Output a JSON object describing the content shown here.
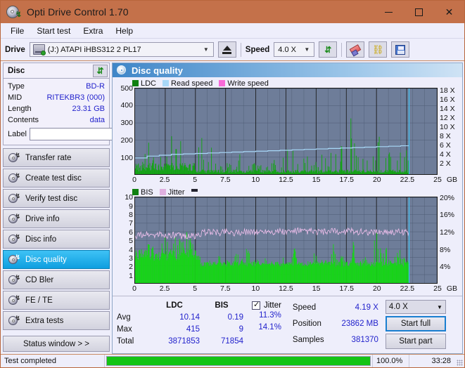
{
  "window": {
    "title": "Opti Drive Control 1.70",
    "icon": "disc-drive-icon",
    "minimize": "—",
    "maximize": "□",
    "close": "✕"
  },
  "menu": {
    "items": [
      {
        "label": "File"
      },
      {
        "label": "Start test"
      },
      {
        "label": "Extra"
      },
      {
        "label": "Help"
      }
    ]
  },
  "toolbar": {
    "drive_label": "Drive",
    "drive_value": "(J:)   ATAPI iHBS312   2 PL17",
    "eject_label": "eject-icon",
    "speed_label": "Speed",
    "speed_value": "4.0 X",
    "refresh_label": "↯",
    "erase_label": "eraser-icon",
    "chain_label": "chain-icon",
    "save_label": "save-icon"
  },
  "disc_panel": {
    "header": "Disc",
    "refresh_icon": "refresh-icon",
    "rows": [
      {
        "key": "Type",
        "value": "BD-R"
      },
      {
        "key": "MID",
        "value": "RITEKBR3 (000)"
      },
      {
        "key": "Length",
        "value": "23.31 GB"
      },
      {
        "key": "Contents",
        "value": "data"
      }
    ],
    "label_key": "Label",
    "label_value": "",
    "label_placeholder": ""
  },
  "sidebar": {
    "items": [
      {
        "label": "Transfer rate",
        "active": false
      },
      {
        "label": "Create test disc",
        "active": false
      },
      {
        "label": "Verify test disc",
        "active": false
      },
      {
        "label": "Drive info",
        "active": false
      },
      {
        "label": "Disc info",
        "active": false
      },
      {
        "label": "Disc quality",
        "active": true
      },
      {
        "label": "CD Bler",
        "active": false
      },
      {
        "label": "FE / TE",
        "active": false
      },
      {
        "label": "Extra tests",
        "active": false
      }
    ],
    "status_window_button": "Status window > >"
  },
  "main": {
    "panel_title": "Disc quality"
  },
  "colors": {
    "ldc": "#108010",
    "bis": "#16c216",
    "read_speed": "#a8d8f8",
    "write_speed": "#f86ad8",
    "jitter": "#e0b0e0",
    "plot_bg": "#6e7d99",
    "accent": "#3f86c8",
    "title_bar": "#c4714a",
    "progress": "#14c414",
    "value_text": "#2222cc"
  },
  "chart_data": [
    {
      "type": "line",
      "id": "disc-quality-top",
      "title": "LDC / Read speed",
      "legend": [
        {
          "label": "LDC",
          "color": "#108010"
        },
        {
          "label": "Read speed",
          "color": "#a8d8f8"
        },
        {
          "label": "Write speed",
          "color": "#f86ad8"
        }
      ],
      "legend_position": "top-left",
      "grid": true,
      "xlabel": "GB",
      "x": [
        0.0,
        2.5,
        5.0,
        7.5,
        10.0,
        12.5,
        15.0,
        17.5,
        20.0,
        22.5,
        25.0
      ],
      "xlim": [
        0.0,
        25.0
      ],
      "ylabel_left": "LDC",
      "yticks_left": [
        100,
        200,
        300,
        400,
        500
      ],
      "ylim_left": [
        0,
        500
      ],
      "ylabel_right": "Speed",
      "yticks_right": [
        "2 X",
        "4 X",
        "6 X",
        "8 X",
        "10 X",
        "12 X",
        "14 X",
        "16 X",
        "18 X"
      ],
      "ylim_right": [
        0,
        19
      ],
      "series": [
        {
          "name": "LDC",
          "color": "#108010",
          "style": "bars",
          "note": "dense green spikes along entire disc; baseline ~10-60, frequent spikes 100-260, tall outliers ~380 near 3.0 GB, ~365 near 20.4 GB, ~240 near 12.5 GB and ~235 near 17.6 GB",
          "samples": [
            [
              0.05,
              225
            ],
            [
              0.2,
              60
            ],
            [
              0.5,
              45
            ],
            [
              0.9,
              150
            ],
            [
              1.1,
              250
            ],
            [
              1.3,
              120
            ],
            [
              1.6,
              95
            ],
            [
              1.9,
              80
            ],
            [
              2.2,
              110
            ],
            [
              2.5,
              70
            ],
            [
              2.8,
              185
            ],
            [
              3.0,
              380
            ],
            [
              3.2,
              140
            ],
            [
              3.5,
              175
            ],
            [
              3.8,
              195
            ],
            [
              4.0,
              130
            ],
            [
              4.3,
              115
            ],
            [
              4.6,
              205
            ],
            [
              4.9,
              90
            ],
            [
              5.2,
              160
            ],
            [
              5.5,
              205
            ],
            [
              5.8,
              75
            ],
            [
              6.1,
              60
            ],
            [
              6.4,
              190
            ],
            [
              6.8,
              55
            ],
            [
              7.2,
              45
            ],
            [
              7.6,
              70
            ],
            [
              8.0,
              50
            ],
            [
              8.5,
              60
            ],
            [
              9.0,
              240
            ],
            [
              9.4,
              55
            ],
            [
              9.8,
              65
            ],
            [
              10.2,
              50
            ],
            [
              10.6,
              60
            ],
            [
              11.0,
              55
            ],
            [
              11.5,
              75
            ],
            [
              12.0,
              60
            ],
            [
              12.4,
              120
            ],
            [
              12.8,
              235
            ],
            [
              13.2,
              80
            ],
            [
              13.6,
              65
            ],
            [
              14.0,
              150
            ],
            [
              14.4,
              70
            ],
            [
              14.8,
              60
            ],
            [
              15.2,
              85
            ],
            [
              15.6,
              190
            ],
            [
              16.0,
              75
            ],
            [
              16.4,
              200
            ],
            [
              16.8,
              120
            ],
            [
              17.2,
              160
            ],
            [
              17.6,
              255
            ],
            [
              18.0,
              300
            ],
            [
              18.3,
              180
            ],
            [
              18.6,
              250
            ],
            [
              19.0,
              120
            ],
            [
              19.4,
              95
            ],
            [
              19.8,
              110
            ],
            [
              20.2,
              365
            ],
            [
              20.6,
              80
            ],
            [
              21.0,
              150
            ],
            [
              21.4,
              130
            ],
            [
              21.8,
              95
            ],
            [
              22.2,
              260
            ],
            [
              22.5,
              110
            ],
            [
              22.7,
              60
            ]
          ]
        },
        {
          "name": "Read speed",
          "color": "#a8d8f8",
          "style": "line",
          "note": "stepped CAV-like read speed curve rising from about 4.0X to 6.5X across the disc",
          "samples": [
            [
              0.0,
              3.6
            ],
            [
              1.0,
              4.0
            ],
            [
              2.0,
              4.2
            ],
            [
              3.0,
              4.4
            ],
            [
              4.0,
              4.5
            ],
            [
              5.0,
              4.6
            ],
            [
              6.0,
              4.7
            ],
            [
              7.0,
              4.8
            ],
            [
              8.0,
              4.9
            ],
            [
              9.0,
              5.0
            ],
            [
              10.0,
              5.1
            ],
            [
              11.0,
              5.2
            ],
            [
              12.0,
              5.3
            ],
            [
              13.0,
              5.4
            ],
            [
              14.0,
              5.5
            ],
            [
              15.0,
              5.6
            ],
            [
              16.0,
              5.7
            ],
            [
              17.0,
              5.8
            ],
            [
              18.0,
              5.9
            ],
            [
              19.0,
              6.0
            ],
            [
              20.0,
              6.1
            ],
            [
              21.0,
              6.2
            ],
            [
              22.0,
              6.3
            ],
            [
              22.7,
              6.5
            ]
          ]
        },
        {
          "name": "Write speed",
          "color": "#f86ad8",
          "style": "line",
          "note": "not plotted (read test)",
          "samples": []
        }
      ],
      "end_marker_x": 22.7
    },
    {
      "type": "line",
      "id": "disc-quality-bottom",
      "title": "BIS / Jitter",
      "legend": [
        {
          "label": "BIS",
          "color": "#16c216"
        },
        {
          "label": "Jitter",
          "color": "#e0b0e0"
        }
      ],
      "legend_position": "top-left",
      "grid": true,
      "xlabel": "GB",
      "x": [
        0.0,
        2.5,
        5.0,
        7.5,
        10.0,
        12.5,
        15.0,
        17.5,
        20.0,
        22.5,
        25.0
      ],
      "xlim": [
        0.0,
        25.0
      ],
      "ylabel_left": "BIS",
      "yticks_left": [
        1,
        2,
        3,
        4,
        5,
        6,
        7,
        8,
        9,
        10
      ],
      "ylim_left": [
        0,
        10
      ],
      "ylabel_right": "Jitter",
      "yticks_right": [
        "4%",
        "8%",
        "12%",
        "16%",
        "20%"
      ],
      "ylim_right": [
        0,
        20
      ],
      "series": [
        {
          "name": "BIS",
          "color": "#16c216",
          "style": "bars",
          "note": "solid green fill; dense band mostly 2-4 with spikes to 5-7 in first 5 GB, then band ~2-3 with periodic spikes to 5-7",
          "samples": [
            [
              0.1,
              3.0
            ],
            [
              0.4,
              2.6
            ],
            [
              0.8,
              4.2
            ],
            [
              1.2,
              5.0
            ],
            [
              1.6,
              4.4
            ],
            [
              2.0,
              5.2
            ],
            [
              2.4,
              4.8
            ],
            [
              2.6,
              7.0
            ],
            [
              3.0,
              4.4
            ],
            [
              3.4,
              5.0
            ],
            [
              3.8,
              4.6
            ],
            [
              4.1,
              7.0
            ],
            [
              4.4,
              5.2
            ],
            [
              4.8,
              4.4
            ],
            [
              5.2,
              3.6
            ],
            [
              5.6,
              2.4
            ],
            [
              6.0,
              3.0
            ],
            [
              6.4,
              2.2
            ],
            [
              6.8,
              3.4
            ],
            [
              7.2,
              2.4
            ],
            [
              7.6,
              3.2
            ],
            [
              8.0,
              2.2
            ],
            [
              8.4,
              4.0
            ],
            [
              8.8,
              2.6
            ],
            [
              9.2,
              7.0
            ],
            [
              9.6,
              2.4
            ],
            [
              10.0,
              3.0
            ],
            [
              10.4,
              2.2
            ],
            [
              10.8,
              3.2
            ],
            [
              11.2,
              2.4
            ],
            [
              11.6,
              3.0
            ],
            [
              12.0,
              2.2
            ],
            [
              12.4,
              3.6
            ],
            [
              12.8,
              2.4
            ],
            [
              13.2,
              4.2
            ],
            [
              13.6,
              2.6
            ],
            [
              14.0,
              3.0
            ],
            [
              14.4,
              2.4
            ],
            [
              14.8,
              4.0
            ],
            [
              15.2,
              2.6
            ],
            [
              15.6,
              3.2
            ],
            [
              16.0,
              2.4
            ],
            [
              16.4,
              4.6
            ],
            [
              16.8,
              2.8
            ],
            [
              17.2,
              3.4
            ],
            [
              17.6,
              2.6
            ],
            [
              18.0,
              5.6
            ],
            [
              18.4,
              3.0
            ],
            [
              18.8,
              2.6
            ],
            [
              19.2,
              3.4
            ],
            [
              19.6,
              2.6
            ],
            [
              20.0,
              7.4
            ],
            [
              20.4,
              3.0
            ],
            [
              20.8,
              4.2
            ],
            [
              21.2,
              2.8
            ],
            [
              21.6,
              3.2
            ],
            [
              22.0,
              4.8
            ],
            [
              22.4,
              3.0
            ],
            [
              22.7,
              2.6
            ]
          ]
        },
        {
          "name": "Jitter",
          "color": "#e0b0e0",
          "style": "line",
          "note": "noisy pink trace averaging about 11.3%, rising slightly from ~11% to ~12% across the disc, peaks to ~14.1%",
          "samples": [
            [
              0.1,
              11.0
            ],
            [
              0.5,
              11.2
            ],
            [
              1.0,
              11.4
            ],
            [
              1.5,
              11.1
            ],
            [
              2.0,
              11.3
            ],
            [
              2.5,
              11.0
            ],
            [
              3.0,
              11.2
            ],
            [
              3.5,
              11.1
            ],
            [
              4.0,
              10.9
            ],
            [
              4.5,
              11.0
            ],
            [
              5.0,
              10.8
            ],
            [
              5.5,
              11.6
            ],
            [
              6.0,
              12.0
            ],
            [
              6.5,
              11.8
            ],
            [
              7.0,
              11.7
            ],
            [
              7.5,
              12.2
            ],
            [
              8.0,
              11.8
            ],
            [
              8.5,
              11.6
            ],
            [
              9.0,
              11.9
            ],
            [
              9.5,
              12.1
            ],
            [
              10.0,
              11.8
            ],
            [
              10.5,
              12.0
            ],
            [
              11.0,
              12.2
            ],
            [
              11.5,
              11.9
            ],
            [
              12.0,
              12.1
            ],
            [
              12.5,
              11.8
            ],
            [
              13.0,
              12.0
            ],
            [
              13.5,
              12.2
            ],
            [
              14.0,
              11.9
            ],
            [
              14.5,
              12.1
            ],
            [
              15.0,
              11.8
            ],
            [
              15.5,
              12.0
            ],
            [
              16.0,
              11.9
            ],
            [
              16.5,
              12.1
            ],
            [
              17.0,
              11.8
            ],
            [
              17.5,
              12.0
            ],
            [
              18.0,
              12.2
            ],
            [
              18.5,
              11.9
            ],
            [
              19.0,
              12.1
            ],
            [
              19.5,
              11.8
            ],
            [
              20.0,
              12.0
            ],
            [
              20.5,
              11.9
            ],
            [
              21.0,
              12.1
            ],
            [
              21.5,
              11.8
            ],
            [
              22.0,
              12.0
            ],
            [
              22.5,
              11.9
            ],
            [
              22.7,
              11.8
            ]
          ]
        }
      ],
      "end_marker_x": 22.7
    }
  ],
  "stats": {
    "headers": {
      "blank": "",
      "ldc": "LDC",
      "bis": "BIS"
    },
    "rows": [
      {
        "label": "Avg",
        "ldc": "10.14",
        "bis": "0.19",
        "jitter": "11.3%"
      },
      {
        "label": "Max",
        "ldc": "415",
        "bis": "9",
        "jitter": "14.1%"
      },
      {
        "label": "Total",
        "ldc": "3871853",
        "bis": "71854",
        "jitter": ""
      }
    ],
    "jitter_label": "Jitter",
    "jitter_checked": true,
    "speed_label": "Speed",
    "speed_value": "4.19 X",
    "position_label": "Position",
    "position_value": "23862 MB",
    "samples_label": "Samples",
    "samples_value": "381370",
    "speed_select": "4.0 X",
    "start_full_button": "Start full",
    "start_part_button": "Start part"
  },
  "statusbar": {
    "message": "Test completed",
    "progress_percent": "100.0%",
    "progress_value": 100,
    "elapsed": "33:28"
  }
}
